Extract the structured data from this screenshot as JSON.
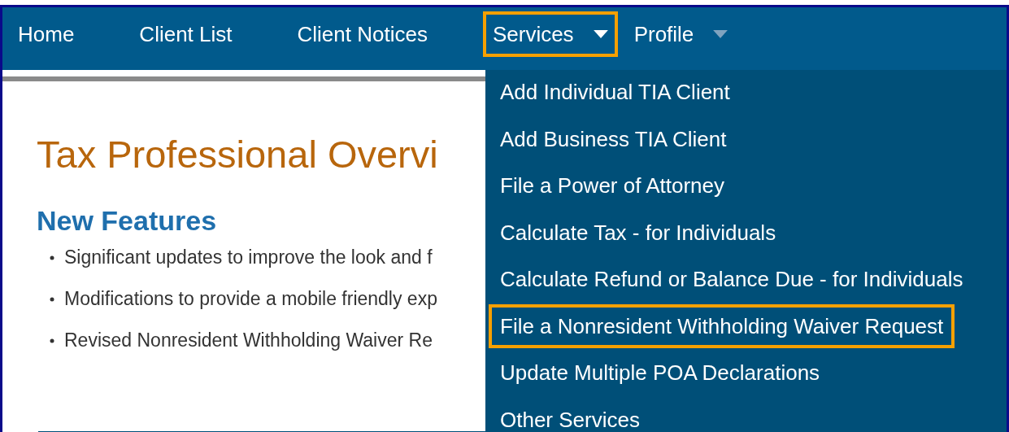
{
  "nav": [
    {
      "label": "Home",
      "dropdown": false,
      "highlighted": false
    },
    {
      "label": "Client List",
      "dropdown": false,
      "highlighted": false
    },
    {
      "label": "Client Notices",
      "dropdown": false,
      "highlighted": false
    },
    {
      "label": "Services",
      "dropdown": true,
      "highlighted": true
    },
    {
      "label": "Profile",
      "dropdown": true,
      "highlighted": false
    }
  ],
  "page": {
    "title": "Tax Professional Overvi",
    "section_heading": "New Features",
    "bullets": [
      "Significant updates to improve the look and f",
      "Modifications to provide a mobile friendly exp",
      "Revised Nonresident Withholding Waiver Re"
    ]
  },
  "services_menu": [
    {
      "label": "Add Individual TIA Client",
      "highlighted": false
    },
    {
      "label": "Add Business TIA Client",
      "highlighted": false
    },
    {
      "label": "File a Power of Attorney",
      "highlighted": false
    },
    {
      "label": "Calculate Tax - for Individuals",
      "highlighted": false
    },
    {
      "label": "Calculate Refund or Balance Due - for Individuals",
      "highlighted": false
    },
    {
      "label": "File a Nonresident Withholding Waiver Request",
      "highlighted": true
    },
    {
      "label": "Update Multiple POA Declarations",
      "highlighted": false
    },
    {
      "label": "Other Services",
      "highlighted": false
    }
  ]
}
